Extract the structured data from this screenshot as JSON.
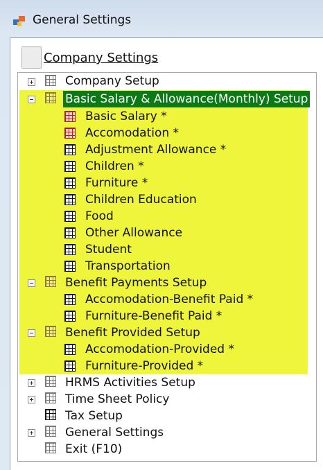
{
  "window": {
    "title": "General Settings"
  },
  "section": {
    "title": "Company Settings"
  },
  "colors": {
    "highlight": "#eef53a",
    "selected_bg": "#0b7a16"
  },
  "tree": {
    "company_setup": "Company Setup",
    "basic_salary_group": "Basic Salary & Allowance(Monthly) Setup",
    "basic_salary_children": [
      "Basic Salary *",
      "Accomodation *",
      "Adjustment Allowance *",
      "Children *",
      "Furniture *",
      "Children Education",
      "Food",
      "Other Allowance",
      "Student",
      "Transportation"
    ],
    "benefit_payments_group": "Benefit Payments Setup",
    "benefit_payments_children": [
      "Accomodation-Benefit Paid *",
      "Furniture-Benefit Paid *"
    ],
    "benefit_provided_group": "Benefit Provided Setup",
    "benefit_provided_children": [
      "Accomodation-Provided *",
      "Furniture-Provided *"
    ],
    "hrms_activities": "HRMS Activities Setup",
    "time_sheet_policy": "Time Sheet Policy",
    "tax_setup": "Tax Setup",
    "general_settings": "General Settings",
    "exit": "Exit (F10)"
  }
}
